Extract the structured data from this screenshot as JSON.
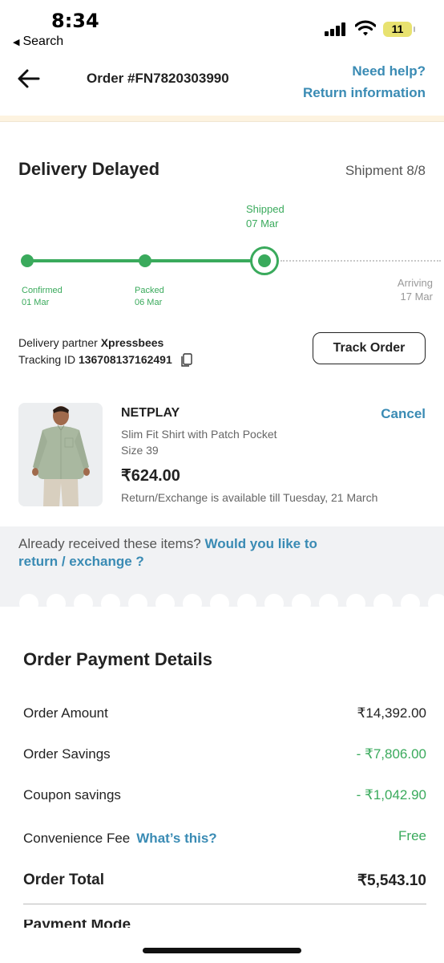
{
  "status_bar": {
    "time": "8:34",
    "back_app": "Search",
    "battery": "11"
  },
  "header": {
    "order_id": "Order #FN7820303990",
    "need_help": "Need help?",
    "return_information": "Return information"
  },
  "delivery": {
    "title": "Delivery Delayed",
    "shipment": "Shipment 8/8",
    "timeline": [
      {
        "label": "Confirmed",
        "date": "01 Mar",
        "status": "done"
      },
      {
        "label": "Packed",
        "date": "06 Mar",
        "status": "done"
      },
      {
        "label": "Shipped",
        "date": "07 Mar",
        "status": "current"
      },
      {
        "label": "Arriving",
        "date": "17 Mar",
        "status": "pending"
      }
    ],
    "partner_label": "Delivery partner",
    "partner_name": "Xpressbees",
    "tracking_label": "Tracking ID",
    "tracking_id": "136708137162491",
    "track_button": "Track Order"
  },
  "product": {
    "brand": "NETPLAY",
    "cancel": "Cancel",
    "name": "Slim Fit Shirt with Patch Pocket",
    "size": "Size 39",
    "price": "₹624.00",
    "return_note": "Return/Exchange is available till Tuesday, 21 March"
  },
  "received": {
    "question": "Already received these items?",
    "link": "Would you like to return / exchange ?"
  },
  "payment": {
    "title": "Order Payment Details",
    "rows": [
      {
        "label": "Order Amount",
        "value": "₹14,392.00"
      },
      {
        "label": "Order Savings",
        "value": "- ₹7,806.00"
      },
      {
        "label": "Coupon savings",
        "value": "- ₹1,042.90"
      },
      {
        "label": "Convenience Fee",
        "link": "What’s this?",
        "value": "Free"
      }
    ],
    "total_label": "Order Total",
    "total_value": "₹5,543.10",
    "next_section": "Payment Mode"
  },
  "colors": {
    "accent_blue": "#3a8bb4",
    "success_green": "#3aaa5c"
  }
}
